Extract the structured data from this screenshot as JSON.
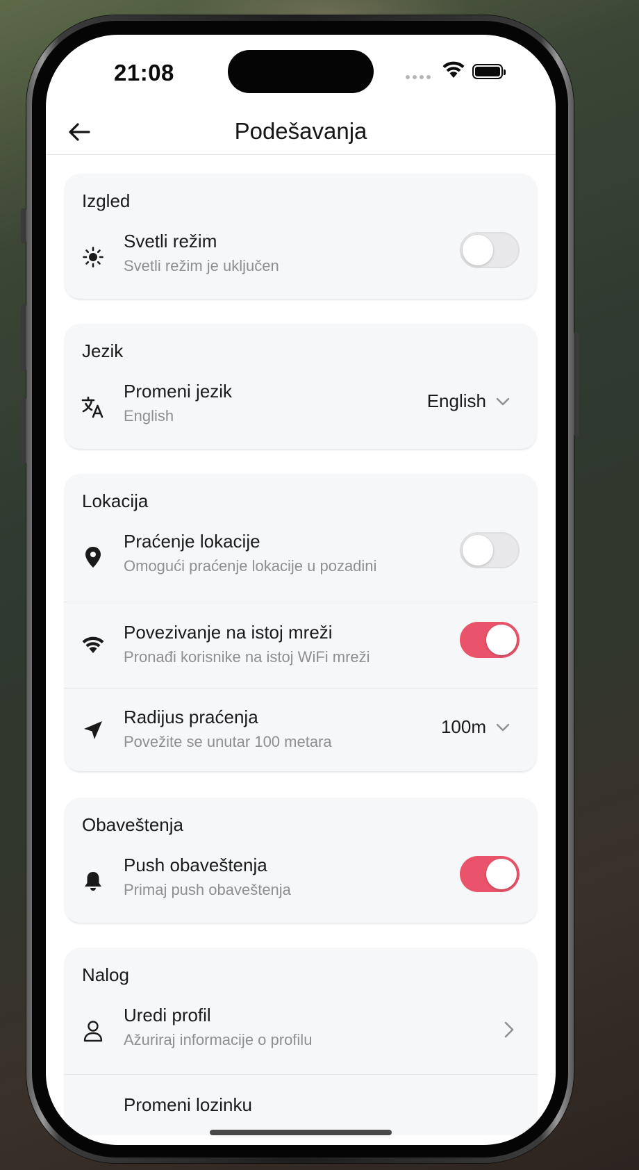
{
  "status_bar": {
    "time": "21:08"
  },
  "header": {
    "title": "Podešavanja",
    "back_icon": "arrow-left-icon"
  },
  "sections": {
    "appearance": {
      "title": "Izgled",
      "light_mode": {
        "label": "Svetli režim",
        "subtitle": "Svetli režim je uključen",
        "icon": "sun-icon",
        "enabled": false
      }
    },
    "language": {
      "title": "Jezik",
      "change_language": {
        "label": "Promeni jezik",
        "subtitle": "English",
        "icon": "translate-icon",
        "value": "English"
      }
    },
    "location": {
      "title": "Lokacija",
      "tracking": {
        "label": "Praćenje lokacije",
        "subtitle": "Omogući praćenje lokacije u pozadini",
        "icon": "location-pin-icon",
        "enabled": false
      },
      "same_network": {
        "label": "Povezivanje na istoj mreži",
        "subtitle": "Pronađi korisnike na istoj WiFi mreži",
        "icon": "wifi-icon",
        "enabled": true
      },
      "radius": {
        "label": "Radijus praćenja",
        "subtitle": "Povežite se unutar 100 metara",
        "icon": "navigation-arrow-icon",
        "value": "100m"
      }
    },
    "notifications": {
      "title": "Obaveštenja",
      "push": {
        "label": "Push obaveštenja",
        "subtitle": "Primaj push obaveštenja",
        "icon": "bell-icon",
        "enabled": true
      }
    },
    "account": {
      "title": "Nalog",
      "edit_profile": {
        "label": "Uredi profil",
        "subtitle": "Ažuriraj informacije o profilu",
        "icon": "user-icon"
      },
      "change_password": {
        "label": "Promeni lozinku"
      }
    }
  },
  "colors": {
    "accent": "#e9546b",
    "card_bg": "#f6f7f9",
    "subtitle": "#8e8e93"
  }
}
